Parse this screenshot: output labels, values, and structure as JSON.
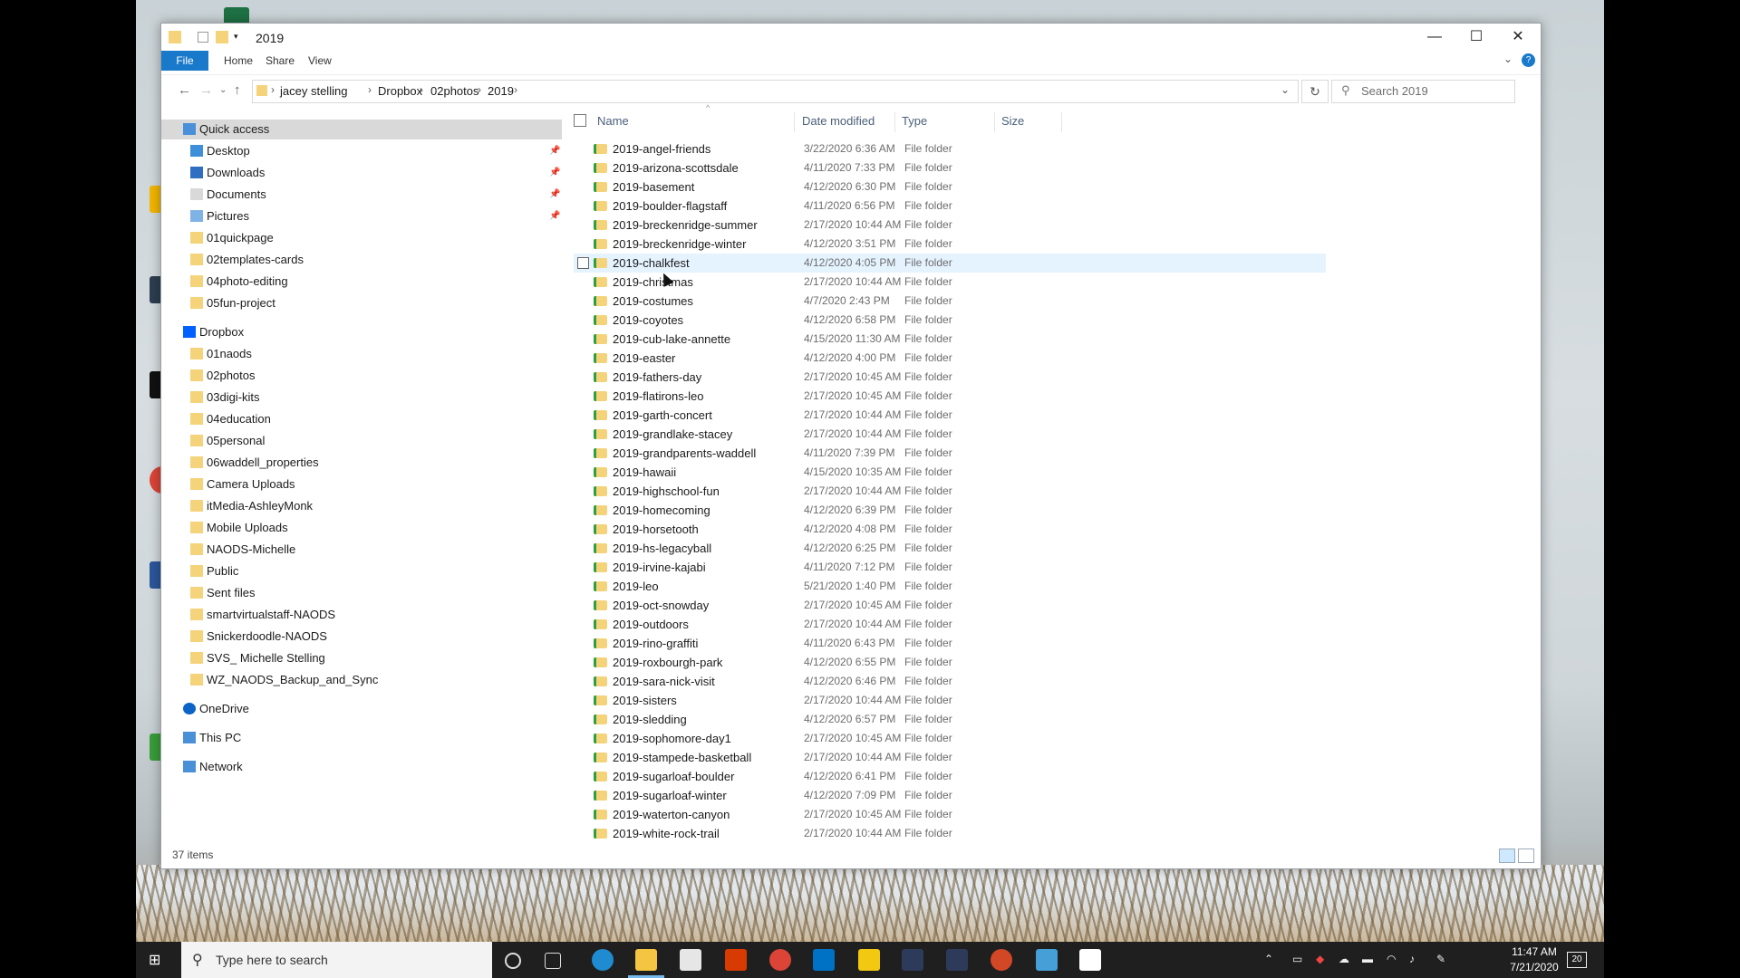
{
  "window": {
    "title": "2019",
    "ribbon_tabs": [
      "File",
      "Home",
      "Share",
      "View"
    ],
    "controls": {
      "minimize": "—",
      "maximize": "☐",
      "close": "✕"
    }
  },
  "address": {
    "breadcrumbs": [
      "jacey stelling",
      "Dropbox",
      "02photos",
      "2019"
    ],
    "search_placeholder": "Search 2019"
  },
  "nav_pane": {
    "quick_access": {
      "label": "Quick access",
      "items": [
        "Desktop",
        "Downloads",
        "Documents",
        "Pictures",
        "01quickpage",
        "02templates-cards",
        "04photo-editing",
        "05fun-project"
      ]
    },
    "dropbox": {
      "label": "Dropbox",
      "items": [
        "01naods",
        "02photos",
        "03digi-kits",
        "04education",
        "05personal",
        "06waddell_properties",
        "Camera Uploads",
        "itMedia-AshleyMonk",
        "Mobile Uploads",
        "NAODS-Michelle",
        "Public",
        "Sent files",
        "smartvirtualstaff-NAODS",
        "Snickerdoodle-NAODS",
        "SVS_ Michelle Stelling",
        "WZ_NAODS_Backup_and_Sync"
      ]
    },
    "onedrive": "OneDrive",
    "this_pc": "This PC",
    "network": "Network"
  },
  "columns": [
    "Name",
    "Date modified",
    "Type",
    "Size"
  ],
  "files": [
    {
      "name": "2019-angel-friends",
      "date": "3/22/2020 6:36 AM",
      "type": "File folder"
    },
    {
      "name": "2019-arizona-scottsdale",
      "date": "4/11/2020 7:33 PM",
      "type": "File folder"
    },
    {
      "name": "2019-basement",
      "date": "4/12/2020 6:30 PM",
      "type": "File folder"
    },
    {
      "name": "2019-boulder-flagstaff",
      "date": "4/11/2020 6:56 PM",
      "type": "File folder"
    },
    {
      "name": "2019-breckenridge-summer",
      "date": "2/17/2020 10:44 AM",
      "type": "File folder"
    },
    {
      "name": "2019-breckenridge-winter",
      "date": "4/12/2020 3:51 PM",
      "type": "File folder"
    },
    {
      "name": "2019-chalkfest",
      "date": "4/12/2020 4:05 PM",
      "type": "File folder"
    },
    {
      "name": "2019-christmas",
      "date": "2/17/2020 10:44 AM",
      "type": "File folder"
    },
    {
      "name": "2019-costumes",
      "date": "4/7/2020 2:43 PM",
      "type": "File folder"
    },
    {
      "name": "2019-coyotes",
      "date": "4/12/2020 6:58 PM",
      "type": "File folder"
    },
    {
      "name": "2019-cub-lake-annette",
      "date": "4/15/2020 11:30 AM",
      "type": "File folder"
    },
    {
      "name": "2019-easter",
      "date": "4/12/2020 4:00 PM",
      "type": "File folder"
    },
    {
      "name": "2019-fathers-day",
      "date": "2/17/2020 10:45 AM",
      "type": "File folder"
    },
    {
      "name": "2019-flatirons-leo",
      "date": "2/17/2020 10:45 AM",
      "type": "File folder"
    },
    {
      "name": "2019-garth-concert",
      "date": "2/17/2020 10:44 AM",
      "type": "File folder"
    },
    {
      "name": "2019-grandlake-stacey",
      "date": "2/17/2020 10:44 AM",
      "type": "File folder"
    },
    {
      "name": "2019-grandparents-waddell",
      "date": "4/11/2020 7:39 PM",
      "type": "File folder"
    },
    {
      "name": "2019-hawaii",
      "date": "4/15/2020 10:35 AM",
      "type": "File folder"
    },
    {
      "name": "2019-highschool-fun",
      "date": "2/17/2020 10:44 AM",
      "type": "File folder"
    },
    {
      "name": "2019-homecoming",
      "date": "4/12/2020 6:39 PM",
      "type": "File folder"
    },
    {
      "name": "2019-horsetooth",
      "date": "4/12/2020 4:08 PM",
      "type": "File folder"
    },
    {
      "name": "2019-hs-legacyball",
      "date": "4/12/2020 6:25 PM",
      "type": "File folder"
    },
    {
      "name": "2019-irvine-kajabi",
      "date": "4/11/2020 7:12 PM",
      "type": "File folder"
    },
    {
      "name": "2019-leo",
      "date": "5/21/2020 1:40 PM",
      "type": "File folder"
    },
    {
      "name": "2019-oct-snowday",
      "date": "2/17/2020 10:45 AM",
      "type": "File folder"
    },
    {
      "name": "2019-outdoors",
      "date": "2/17/2020 10:44 AM",
      "type": "File folder"
    },
    {
      "name": "2019-rino-graffiti",
      "date": "4/11/2020 6:43 PM",
      "type": "File folder"
    },
    {
      "name": "2019-roxbourgh-park",
      "date": "4/12/2020 6:55 PM",
      "type": "File folder"
    },
    {
      "name": "2019-sara-nick-visit",
      "date": "4/12/2020 6:46 PM",
      "type": "File folder"
    },
    {
      "name": "2019-sisters",
      "date": "2/17/2020 10:44 AM",
      "type": "File folder"
    },
    {
      "name": "2019-sledding",
      "date": "4/12/2020 6:57 PM",
      "type": "File folder"
    },
    {
      "name": "2019-sophomore-day1",
      "date": "2/17/2020 10:45 AM",
      "type": "File folder"
    },
    {
      "name": "2019-stampede-basketball",
      "date": "2/17/2020 10:44 AM",
      "type": "File folder"
    },
    {
      "name": "2019-sugarloaf-boulder",
      "date": "4/12/2020 6:41 PM",
      "type": "File folder"
    },
    {
      "name": "2019-sugarloaf-winter",
      "date": "4/12/2020 7:09 PM",
      "type": "File folder"
    },
    {
      "name": "2019-waterton-canyon",
      "date": "2/17/2020 10:45 AM",
      "type": "File folder"
    },
    {
      "name": "2019-white-rock-trail",
      "date": "2/17/2020 10:44 AM",
      "type": "File folder"
    }
  ],
  "status": {
    "item_count": "37 items"
  },
  "taskbar": {
    "search_placeholder": "Type here to search",
    "time": "11:47 AM",
    "date": "7/21/2020",
    "notification_count": "20"
  },
  "colors": {
    "accent": "#1979ca",
    "hover_row": "#e5f3ff",
    "folder": "#f4d37a",
    "sync_badge": "#2e9f3e",
    "taskbar": "#1f1f1f"
  }
}
